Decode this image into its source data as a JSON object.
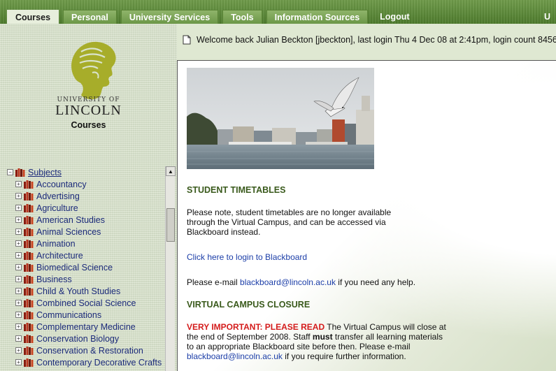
{
  "tabs": [
    {
      "label": "Courses",
      "active": true
    },
    {
      "label": "Personal",
      "active": false
    },
    {
      "label": "University Services",
      "active": false
    },
    {
      "label": "Tools",
      "active": false
    },
    {
      "label": "Information Sources",
      "active": false
    },
    {
      "label": "Logout",
      "active": false
    }
  ],
  "tab_cutoff_text": "U",
  "sidebar": {
    "university_of": "UNIVERSITY OF",
    "university_name": "LINCOLN",
    "courses_heading": "Courses",
    "tree_root": "Subjects",
    "tree_items": [
      "Accountancy",
      "Advertising",
      "Agriculture",
      "American Studies",
      "Animal Sciences",
      "Animation",
      "Architecture",
      "Biomedical Science",
      "Business",
      "Child & Youth Studies",
      "Combined Social Science",
      "Communications",
      "Complementary Medicine",
      "Conservation Biology",
      "Conservation & Restoration",
      "Contemporary Decorative Crafts"
    ]
  },
  "welcome": {
    "text": "Welcome back Julian Beckton [jbeckton], last login Thu 4 Dec 08 at 2:41pm, login count 8456"
  },
  "content": {
    "timetables_heading": "STUDENT TIMETABLES",
    "timetables_text": "Please note, student timetables are no longer available through the Virtual Campus, and can be accessed via Blackboard instead.",
    "blackboard_link": "Click here to login to Blackboard",
    "email_prefix": "Please e-mail ",
    "email_address": "blackboard@lincoln.ac.uk",
    "email_suffix": " if you need any help.",
    "closure_heading": "VIRTUAL CAMPUS CLOSURE",
    "closure_alert": "VERY IMPORTANT: PLEASE READ",
    "closure_text_1": " The Virtual Campus will close at the end of September 2008. Staff ",
    "closure_must": "must",
    "closure_text_2": " transfer all learning materials to an appropriate Blackboard site before then. Please e-mail ",
    "closure_email": "blackboard@lincoln.ac.uk",
    "closure_text_3": " if you require further information."
  },
  "colors": {
    "tab_bar": "#5a8436",
    "heading_green": "#3a5a1c",
    "alert_red": "#d41b1b",
    "link_blue": "#1c3ea8"
  }
}
